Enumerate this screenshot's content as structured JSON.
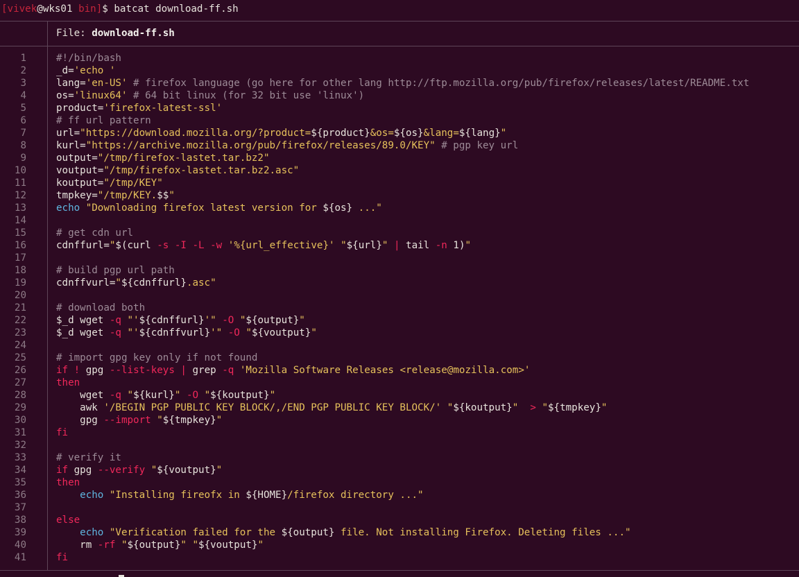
{
  "prompt": {
    "open_bracket": "[",
    "user": "vivek",
    "at": "@",
    "host": "wks01",
    "space": " ",
    "dir": "bin",
    "close_bracket": "]",
    "dollar": "$ ",
    "command": "batcat download-ff.sh"
  },
  "file_header": {
    "label": "File: ",
    "filename": "download-ff.sh"
  },
  "colors": {
    "background": "#2d0a22",
    "text": "#e7e3dc",
    "comment": "#9d8b97",
    "string": "#e6c15b",
    "keyword": "#f0285a",
    "builtin": "#5fb6e0",
    "line_number": "#8d7a86",
    "grid_line": "#5e4558"
  },
  "lines": [
    {
      "num": "1",
      "tokens": [
        {
          "t": "c",
          "v": "#!/bin/bash"
        }
      ]
    },
    {
      "num": "2",
      "tokens": [
        {
          "t": "p",
          "v": "_d="
        },
        {
          "t": "s",
          "v": "'echo '"
        }
      ]
    },
    {
      "num": "3",
      "tokens": [
        {
          "t": "p",
          "v": "lang="
        },
        {
          "t": "s",
          "v": "'en-US'"
        },
        {
          "t": "c",
          "v": " # firefox language (go here for other lang http://ftp.mozilla.org/pub/firefox/releases/latest/README.txt"
        }
      ]
    },
    {
      "num": "4",
      "tokens": [
        {
          "t": "p",
          "v": "os="
        },
        {
          "t": "s",
          "v": "'linux64'"
        },
        {
          "t": "c",
          "v": " # 64 bit linux (for 32 bit use 'linux')"
        }
      ]
    },
    {
      "num": "5",
      "tokens": [
        {
          "t": "p",
          "v": "product="
        },
        {
          "t": "s",
          "v": "'firefox-latest-ssl'"
        }
      ]
    },
    {
      "num": "6",
      "tokens": [
        {
          "t": "c",
          "v": "# ff url pattern"
        }
      ]
    },
    {
      "num": "7",
      "tokens": [
        {
          "t": "p",
          "v": "url="
        },
        {
          "t": "s",
          "v": "\"https://download.mozilla.org/?product="
        },
        {
          "t": "p",
          "v": "${product}"
        },
        {
          "t": "s",
          "v": "&os="
        },
        {
          "t": "p",
          "v": "${os}"
        },
        {
          "t": "s",
          "v": "&lang="
        },
        {
          "t": "p",
          "v": "${lang}"
        },
        {
          "t": "s",
          "v": "\""
        }
      ]
    },
    {
      "num": "8",
      "tokens": [
        {
          "t": "p",
          "v": "kurl="
        },
        {
          "t": "s",
          "v": "\"https://archive.mozilla.org/pub/firefox/releases/89.0/KEY\""
        },
        {
          "t": "c",
          "v": " # pgp key url"
        }
      ]
    },
    {
      "num": "9",
      "tokens": [
        {
          "t": "p",
          "v": "output="
        },
        {
          "t": "s",
          "v": "\"/tmp/firefox-lastet.tar.bz2\""
        }
      ]
    },
    {
      "num": "10",
      "tokens": [
        {
          "t": "p",
          "v": "voutput="
        },
        {
          "t": "s",
          "v": "\"/tmp/firefox-lastet.tar.bz2.asc\""
        }
      ]
    },
    {
      "num": "11",
      "tokens": [
        {
          "t": "p",
          "v": "koutput="
        },
        {
          "t": "s",
          "v": "\"/tmp/KEY\""
        }
      ]
    },
    {
      "num": "12",
      "tokens": [
        {
          "t": "p",
          "v": "tmpkey="
        },
        {
          "t": "s",
          "v": "\"/tmp/KEY."
        },
        {
          "t": "p",
          "v": "$$"
        },
        {
          "t": "s",
          "v": "\""
        }
      ]
    },
    {
      "num": "13",
      "tokens": [
        {
          "t": "b",
          "v": "echo"
        },
        {
          "t": "s",
          "v": " \"Downloading firefox latest version for "
        },
        {
          "t": "p",
          "v": "${os}"
        },
        {
          "t": "s",
          "v": " ...\""
        }
      ]
    },
    {
      "num": "14",
      "tokens": []
    },
    {
      "num": "15",
      "tokens": [
        {
          "t": "c",
          "v": "# get cdn url"
        }
      ]
    },
    {
      "num": "16",
      "tokens": [
        {
          "t": "p",
          "v": "cdnffurl="
        },
        {
          "t": "s",
          "v": "\""
        },
        {
          "t": "p",
          "v": "$(curl "
        },
        {
          "t": "k",
          "v": "-s"
        },
        {
          "t": "p",
          "v": " "
        },
        {
          "t": "k",
          "v": "-I"
        },
        {
          "t": "p",
          "v": " "
        },
        {
          "t": "k",
          "v": "-L"
        },
        {
          "t": "p",
          "v": " "
        },
        {
          "t": "k",
          "v": "-w"
        },
        {
          "t": "p",
          "v": " "
        },
        {
          "t": "s",
          "v": "'%{url_effective}'"
        },
        {
          "t": "p",
          "v": " "
        },
        {
          "t": "s",
          "v": "\""
        },
        {
          "t": "p",
          "v": "${url}"
        },
        {
          "t": "s",
          "v": "\""
        },
        {
          "t": "p",
          "v": " "
        },
        {
          "t": "k",
          "v": "|"
        },
        {
          "t": "p",
          "v": " tail "
        },
        {
          "t": "k",
          "v": "-n"
        },
        {
          "t": "p",
          "v": " 1)"
        },
        {
          "t": "s",
          "v": "\""
        }
      ]
    },
    {
      "num": "17",
      "tokens": []
    },
    {
      "num": "18",
      "tokens": [
        {
          "t": "c",
          "v": "# build pgp url path"
        }
      ]
    },
    {
      "num": "19",
      "tokens": [
        {
          "t": "p",
          "v": "cdnffvurl="
        },
        {
          "t": "s",
          "v": "\""
        },
        {
          "t": "p",
          "v": "${cdnffurl}"
        },
        {
          "t": "s",
          "v": ".asc\""
        }
      ]
    },
    {
      "num": "20",
      "tokens": []
    },
    {
      "num": "21",
      "tokens": [
        {
          "t": "c",
          "v": "# download both"
        }
      ]
    },
    {
      "num": "22",
      "tokens": [
        {
          "t": "p",
          "v": "$_d wget "
        },
        {
          "t": "k",
          "v": "-q"
        },
        {
          "t": "p",
          "v": " "
        },
        {
          "t": "s",
          "v": "\"'"
        },
        {
          "t": "p",
          "v": "${cdnffurl}"
        },
        {
          "t": "s",
          "v": "'\""
        },
        {
          "t": "p",
          "v": " "
        },
        {
          "t": "k",
          "v": "-O"
        },
        {
          "t": "p",
          "v": " "
        },
        {
          "t": "s",
          "v": "\""
        },
        {
          "t": "p",
          "v": "${output}"
        },
        {
          "t": "s",
          "v": "\""
        }
      ]
    },
    {
      "num": "23",
      "tokens": [
        {
          "t": "p",
          "v": "$_d wget "
        },
        {
          "t": "k",
          "v": "-q"
        },
        {
          "t": "p",
          "v": " "
        },
        {
          "t": "s",
          "v": "\"'"
        },
        {
          "t": "p",
          "v": "${cdnffvurl}"
        },
        {
          "t": "s",
          "v": "'\""
        },
        {
          "t": "p",
          "v": " "
        },
        {
          "t": "k",
          "v": "-O"
        },
        {
          "t": "p",
          "v": " "
        },
        {
          "t": "s",
          "v": "\""
        },
        {
          "t": "p",
          "v": "${voutput}"
        },
        {
          "t": "s",
          "v": "\""
        }
      ]
    },
    {
      "num": "24",
      "tokens": []
    },
    {
      "num": "25",
      "tokens": [
        {
          "t": "c",
          "v": "# import gpg key only if not found"
        }
      ]
    },
    {
      "num": "26",
      "tokens": [
        {
          "t": "k",
          "v": "if"
        },
        {
          "t": "p",
          "v": " "
        },
        {
          "t": "k",
          "v": "!"
        },
        {
          "t": "p",
          "v": " gpg "
        },
        {
          "t": "k",
          "v": "--list-keys"
        },
        {
          "t": "p",
          "v": " "
        },
        {
          "t": "k",
          "v": "|"
        },
        {
          "t": "p",
          "v": " grep "
        },
        {
          "t": "k",
          "v": "-q"
        },
        {
          "t": "p",
          "v": " "
        },
        {
          "t": "s",
          "v": "'Mozilla Software Releases <release@mozilla.com>'"
        }
      ]
    },
    {
      "num": "27",
      "tokens": [
        {
          "t": "k",
          "v": "then"
        }
      ]
    },
    {
      "num": "28",
      "tokens": [
        {
          "t": "p",
          "v": "    wget "
        },
        {
          "t": "k",
          "v": "-q"
        },
        {
          "t": "p",
          "v": " "
        },
        {
          "t": "s",
          "v": "\""
        },
        {
          "t": "p",
          "v": "${kurl}"
        },
        {
          "t": "s",
          "v": "\""
        },
        {
          "t": "p",
          "v": " "
        },
        {
          "t": "k",
          "v": "-O"
        },
        {
          "t": "p",
          "v": " "
        },
        {
          "t": "s",
          "v": "\""
        },
        {
          "t": "p",
          "v": "${koutput}"
        },
        {
          "t": "s",
          "v": "\""
        }
      ]
    },
    {
      "num": "29",
      "tokens": [
        {
          "t": "p",
          "v": "    awk "
        },
        {
          "t": "s",
          "v": "'/BEGIN PGP PUBLIC KEY BLOCK/,/END PGP PUBLIC KEY BLOCK/'"
        },
        {
          "t": "p",
          "v": " "
        },
        {
          "t": "s",
          "v": "\""
        },
        {
          "t": "p",
          "v": "${koutput}"
        },
        {
          "t": "s",
          "v": "\""
        },
        {
          "t": "p",
          "v": "  "
        },
        {
          "t": "k",
          "v": ">"
        },
        {
          "t": "p",
          "v": " "
        },
        {
          "t": "s",
          "v": "\""
        },
        {
          "t": "p",
          "v": "${tmpkey}"
        },
        {
          "t": "s",
          "v": "\""
        }
      ]
    },
    {
      "num": "30",
      "tokens": [
        {
          "t": "p",
          "v": "    gpg "
        },
        {
          "t": "k",
          "v": "--import"
        },
        {
          "t": "p",
          "v": " "
        },
        {
          "t": "s",
          "v": "\""
        },
        {
          "t": "p",
          "v": "${tmpkey}"
        },
        {
          "t": "s",
          "v": "\""
        }
      ]
    },
    {
      "num": "31",
      "tokens": [
        {
          "t": "k",
          "v": "fi"
        }
      ]
    },
    {
      "num": "32",
      "tokens": []
    },
    {
      "num": "33",
      "tokens": [
        {
          "t": "c",
          "v": "# verify it"
        }
      ]
    },
    {
      "num": "34",
      "tokens": [
        {
          "t": "k",
          "v": "if"
        },
        {
          "t": "p",
          "v": " gpg "
        },
        {
          "t": "k",
          "v": "--verify"
        },
        {
          "t": "p",
          "v": " "
        },
        {
          "t": "s",
          "v": "\""
        },
        {
          "t": "p",
          "v": "${voutput}"
        },
        {
          "t": "s",
          "v": "\""
        }
      ]
    },
    {
      "num": "35",
      "tokens": [
        {
          "t": "k",
          "v": "then"
        }
      ]
    },
    {
      "num": "36",
      "tokens": [
        {
          "t": "p",
          "v": "    "
        },
        {
          "t": "b",
          "v": "echo"
        },
        {
          "t": "s",
          "v": " \"Installing fireofx in "
        },
        {
          "t": "p",
          "v": "${HOME}"
        },
        {
          "t": "s",
          "v": "/firefox directory ...\""
        }
      ]
    },
    {
      "num": "37",
      "tokens": []
    },
    {
      "num": "38",
      "tokens": [
        {
          "t": "k",
          "v": "else"
        }
      ]
    },
    {
      "num": "39",
      "tokens": [
        {
          "t": "p",
          "v": "    "
        },
        {
          "t": "b",
          "v": "echo"
        },
        {
          "t": "s",
          "v": " \"Verification failed for the "
        },
        {
          "t": "p",
          "v": "${output}"
        },
        {
          "t": "s",
          "v": " file. Not installing Firefox. Deleting files ...\""
        }
      ]
    },
    {
      "num": "40",
      "tokens": [
        {
          "t": "p",
          "v": "    rm "
        },
        {
          "t": "k",
          "v": "-rf"
        },
        {
          "t": "p",
          "v": " "
        },
        {
          "t": "s",
          "v": "\""
        },
        {
          "t": "p",
          "v": "${output}"
        },
        {
          "t": "s",
          "v": "\""
        },
        {
          "t": "p",
          "v": " "
        },
        {
          "t": "s",
          "v": "\""
        },
        {
          "t": "p",
          "v": "${voutput}"
        },
        {
          "t": "s",
          "v": "\""
        }
      ]
    },
    {
      "num": "41",
      "tokens": [
        {
          "t": "k",
          "v": "fi"
        }
      ]
    }
  ]
}
